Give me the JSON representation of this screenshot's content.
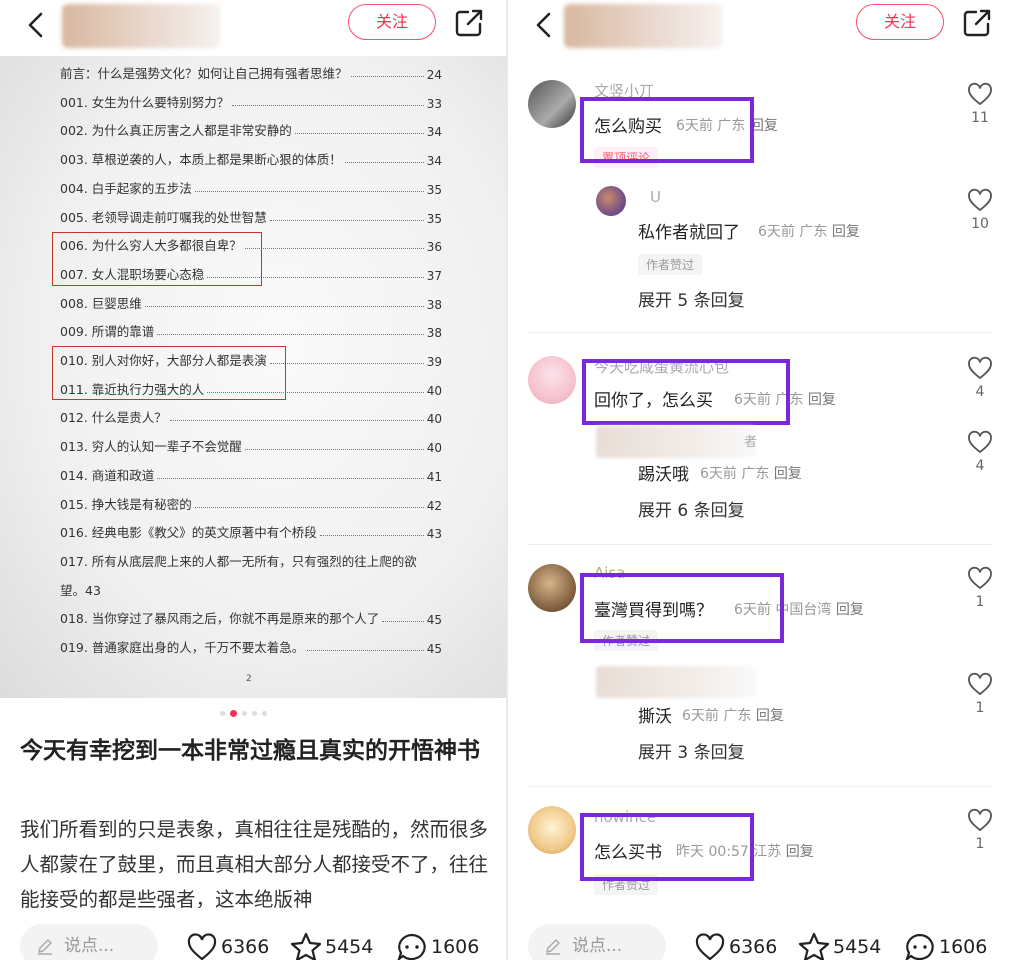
{
  "left": {
    "header": {
      "follow_label": "关注"
    },
    "toc": [
      {
        "title": "前言：什么是强势文化？如何让自己拥有强者思维？",
        "page": "24"
      },
      {
        "title": "001. 女生为什么要特别努力？",
        "page": "33"
      },
      {
        "title": "002. 为什么真正厉害之人都是非常安静的",
        "page": "34"
      },
      {
        "title": "003. 草根逆袭的人，本质上都是果断心狠的体质！",
        "page": "34"
      },
      {
        "title": "004. 白手起家的五步法",
        "page": "35"
      },
      {
        "title": "005. 老领导调走前叮嘱我的处世智慧",
        "page": "35"
      },
      {
        "title": "006. 为什么穷人大多都很自卑？",
        "page": "36"
      },
      {
        "title": "007. 女人混职场要心态稳",
        "page": "37"
      },
      {
        "title": "008. 巨婴思维",
        "page": "38"
      },
      {
        "title": "009. 所谓的靠谱",
        "page": "38"
      },
      {
        "title": "010. 别人对你好，大部分人都是表演",
        "page": "39"
      },
      {
        "title": "011. 靠近执行力强大的人",
        "page": "40"
      },
      {
        "title": "012. 什么是贵人？",
        "page": "40"
      },
      {
        "title": "013. 穷人的认知一辈子不会觉醒",
        "page": "40"
      },
      {
        "title": "014. 商道和政道",
        "page": "41"
      },
      {
        "title": "015. 挣大钱是有秘密的",
        "page": "42"
      },
      {
        "title": "016. 经典电影《教父》的英文原著中有个桥段",
        "page": "43"
      },
      {
        "title": "017. 所有从底层爬上来的人都一无所有，只有强烈的往上爬的欲",
        "page": ""
      },
      {
        "title": "望。43",
        "page": ""
      },
      {
        "title": "018. 当你穿过了暴风雨之后，你就不再是原来的那个人了",
        "page": "45"
      },
      {
        "title": "019. 普通家庭出身的人，千万不要太着急。",
        "page": "45"
      }
    ],
    "page_number": "2",
    "post_title": "今天有幸挖到一本非常过瘾且真实的开悟神书",
    "post_body": "我们所看到的只是表象，真相往往是残酷的，然而很多人都蒙在了鼓里，而且真相大部分人都接受不了，往往能接受的都是些强者，这本绝版神"
  },
  "right": {
    "header": {
      "follow_label": "关注"
    },
    "comments": [
      {
        "name": "文竖小丌",
        "text": "怎么购买",
        "time": "6天前",
        "location": "广东",
        "reply": "回复",
        "likes": "11",
        "tag": "置顶评论",
        "replies": [
          {
            "name": "U",
            "text": "私作者就回了",
            "time": "6天前",
            "location": "广东",
            "reply": "回复",
            "likes": "10",
            "tag": "作者赞过"
          }
        ],
        "expand": "展开 5 条回复"
      },
      {
        "name": "今天吃咸蛋黄流心包",
        "text": "回你了，怎么买",
        "time": "6天前",
        "location": "广东",
        "reply": "回复",
        "likes": "4",
        "replies": [
          {
            "name": "者",
            "text": "踢沃哦",
            "time": "6天前",
            "location": "广东",
            "reply": "回复",
            "likes": "4"
          }
        ],
        "expand": "展开 6 条回复"
      },
      {
        "name": "Aisa",
        "text": "臺灣買得到嗎？",
        "time": "6天前",
        "location": "中国台湾",
        "reply": "回复",
        "likes": "1",
        "tag": "作者赞过",
        "replies": [
          {
            "name": "",
            "text": "撕沃",
            "time": "6天前",
            "location": "广东",
            "reply": "回复",
            "likes": "1"
          }
        ],
        "expand": "展开 3 条回复"
      },
      {
        "name": "nowince",
        "text": "怎么买书",
        "time": "昨天 00:57",
        "location": "江苏",
        "reply": "回复",
        "likes": "1",
        "tag": "作者赞过"
      }
    ]
  },
  "bottom": {
    "say_placeholder": "说点...",
    "likes": "6366",
    "stars": "5454",
    "comments": "1606"
  },
  "colors": {
    "accent": "#ff2e55",
    "highlight_box": "#7a28d9",
    "toc_box": "#c0392b"
  }
}
